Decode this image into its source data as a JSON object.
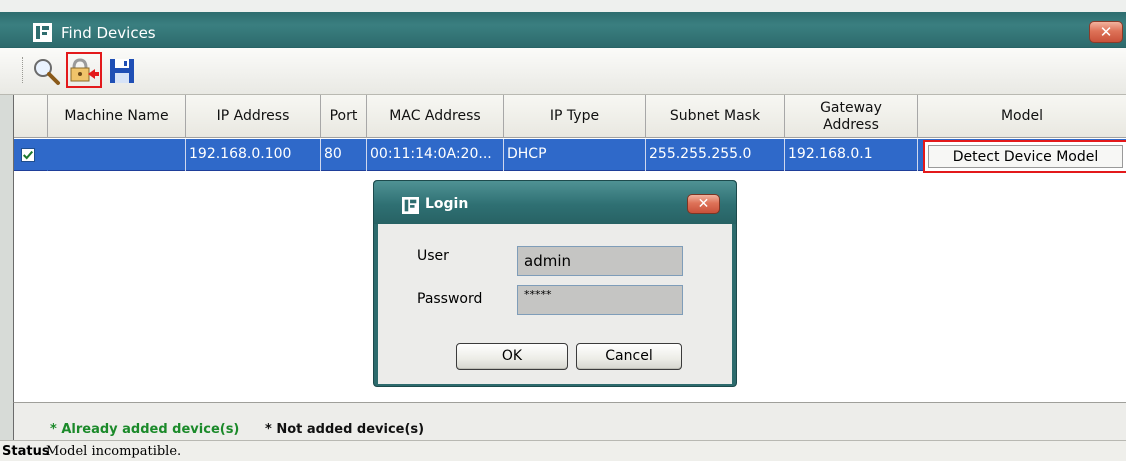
{
  "window": {
    "title": "Find Devices",
    "close_glyph": "✕"
  },
  "toolbar": {
    "icons": [
      "search-icon",
      "login-icon",
      "save-icon"
    ]
  },
  "table": {
    "columns": [
      "Machine Name",
      "IP Address",
      "Port",
      "MAC Address",
      "IP Type",
      "Subnet Mask",
      "Gateway Address",
      "Model"
    ],
    "rows": [
      {
        "checked": true,
        "machine_name": "",
        "ip_address": "192.168.0.100",
        "port": "80",
        "mac_address": "00:11:14:0A:20...",
        "ip_type": "DHCP",
        "subnet_mask": "255.255.255.0",
        "gateway": "192.168.0.1",
        "model_button": "Detect Device Model"
      }
    ],
    "selected_row_color": "#2f69c9"
  },
  "login": {
    "title": "Login",
    "close_glyph": "✕",
    "user_label": "User",
    "user_value": "admin",
    "password_label": "Password",
    "password_value": "*****",
    "ok": "OK",
    "cancel": "Cancel"
  },
  "legend": {
    "added": "* Already added device(s)",
    "not_added": "* Not added device(s)",
    "added_color": "#1b8a2a"
  },
  "status": {
    "label": "Status",
    "text": "Model incompatible."
  },
  "accent": {
    "title_bar": "#2e6d6f",
    "highlight_border": "#e3191b"
  }
}
